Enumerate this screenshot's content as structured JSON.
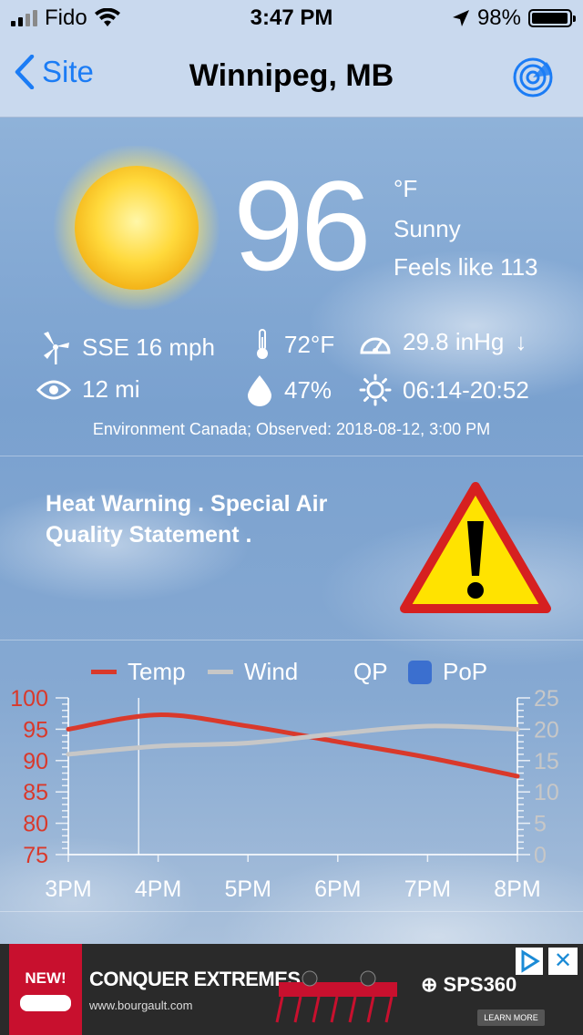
{
  "status_bar": {
    "carrier": "Fido",
    "time": "3:47 PM",
    "battery": "98%",
    "battery_level": 0.98
  },
  "nav": {
    "back_label": "Site",
    "title": "Winnipeg, MB",
    "radar_icon": "radar-icon"
  },
  "current": {
    "temperature": "96",
    "unit": "°F",
    "condition": "Sunny",
    "feels_like": "Feels like 113",
    "wind": "SSE 16 mph",
    "dewpoint": "72°F",
    "pressure": "29.8 inHg",
    "pressure_trend": "↓",
    "visibility": "12 mi",
    "humidity": "47%",
    "sunrise_sunset": "06:14-20:52",
    "source": "Environment Canada; Observed: 2018-08-12, 3:00 PM"
  },
  "warning": {
    "text": "Heat Warning . Special Air Quality Statement ."
  },
  "legend": {
    "temp": "Temp",
    "wind": "Wind",
    "qp": "QP",
    "pop": "PoP"
  },
  "colors": {
    "temp": "#d9392b",
    "wind": "#c7c7c7",
    "pop": "#3b6fcf",
    "accent": "#1b7cf5"
  },
  "chart_data": {
    "type": "line",
    "categories": [
      "3PM",
      "4PM",
      "5PM",
      "6PM",
      "7PM",
      "8PM"
    ],
    "series": [
      {
        "name": "Temp",
        "axis": "left",
        "values": [
          95,
          97.3,
          95.5,
          93,
          90.5,
          87.5
        ]
      },
      {
        "name": "Wind",
        "axis": "right",
        "values": [
          16,
          17.3,
          17.8,
          19.3,
          20.5,
          20
        ]
      }
    ],
    "y_left": {
      "range": [
        75,
        100
      ],
      "ticks": [
        "75",
        "80",
        "85",
        "90",
        "95",
        "100"
      ]
    },
    "y_right": {
      "range": [
        0,
        25
      ],
      "ticks": [
        "0",
        "5",
        "10",
        "15",
        "20",
        "25"
      ]
    },
    "current_time_marker": "3:47 PM"
  },
  "ad": {
    "badge": "NEW!",
    "headline": "CONQUER EXTREMES.",
    "url": "www.bourgault.com",
    "brand": "⊕ SPS360",
    "button": "LEARN MORE"
  }
}
